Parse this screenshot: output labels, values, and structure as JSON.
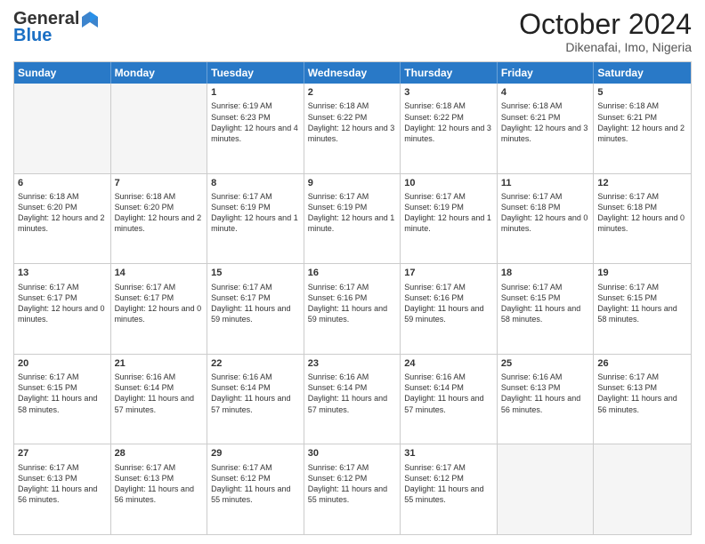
{
  "header": {
    "logo_general": "General",
    "logo_blue": "Blue",
    "month_title": "October 2024",
    "location": "Dikenafai, Imo, Nigeria"
  },
  "days_of_week": [
    "Sunday",
    "Monday",
    "Tuesday",
    "Wednesday",
    "Thursday",
    "Friday",
    "Saturday"
  ],
  "weeks": [
    [
      {
        "day": "",
        "empty": true
      },
      {
        "day": "",
        "empty": true
      },
      {
        "day": "1",
        "sunrise": "6:19 AM",
        "sunset": "6:23 PM",
        "daylight": "12 hours and 4 minutes."
      },
      {
        "day": "2",
        "sunrise": "6:18 AM",
        "sunset": "6:22 PM",
        "daylight": "12 hours and 3 minutes."
      },
      {
        "day": "3",
        "sunrise": "6:18 AM",
        "sunset": "6:22 PM",
        "daylight": "12 hours and 3 minutes."
      },
      {
        "day": "4",
        "sunrise": "6:18 AM",
        "sunset": "6:21 PM",
        "daylight": "12 hours and 3 minutes."
      },
      {
        "day": "5",
        "sunrise": "6:18 AM",
        "sunset": "6:21 PM",
        "daylight": "12 hours and 2 minutes."
      }
    ],
    [
      {
        "day": "6",
        "sunrise": "6:18 AM",
        "sunset": "6:20 PM",
        "daylight": "12 hours and 2 minutes."
      },
      {
        "day": "7",
        "sunrise": "6:18 AM",
        "sunset": "6:20 PM",
        "daylight": "12 hours and 2 minutes."
      },
      {
        "day": "8",
        "sunrise": "6:17 AM",
        "sunset": "6:19 PM",
        "daylight": "12 hours and 1 minute."
      },
      {
        "day": "9",
        "sunrise": "6:17 AM",
        "sunset": "6:19 PM",
        "daylight": "12 hours and 1 minute."
      },
      {
        "day": "10",
        "sunrise": "6:17 AM",
        "sunset": "6:19 PM",
        "daylight": "12 hours and 1 minute."
      },
      {
        "day": "11",
        "sunrise": "6:17 AM",
        "sunset": "6:18 PM",
        "daylight": "12 hours and 0 minutes."
      },
      {
        "day": "12",
        "sunrise": "6:17 AM",
        "sunset": "6:18 PM",
        "daylight": "12 hours and 0 minutes."
      }
    ],
    [
      {
        "day": "13",
        "sunrise": "6:17 AM",
        "sunset": "6:17 PM",
        "daylight": "12 hours and 0 minutes."
      },
      {
        "day": "14",
        "sunrise": "6:17 AM",
        "sunset": "6:17 PM",
        "daylight": "12 hours and 0 minutes."
      },
      {
        "day": "15",
        "sunrise": "6:17 AM",
        "sunset": "6:17 PM",
        "daylight": "11 hours and 59 minutes."
      },
      {
        "day": "16",
        "sunrise": "6:17 AM",
        "sunset": "6:16 PM",
        "daylight": "11 hours and 59 minutes."
      },
      {
        "day": "17",
        "sunrise": "6:17 AM",
        "sunset": "6:16 PM",
        "daylight": "11 hours and 59 minutes."
      },
      {
        "day": "18",
        "sunrise": "6:17 AM",
        "sunset": "6:15 PM",
        "daylight": "11 hours and 58 minutes."
      },
      {
        "day": "19",
        "sunrise": "6:17 AM",
        "sunset": "6:15 PM",
        "daylight": "11 hours and 58 minutes."
      }
    ],
    [
      {
        "day": "20",
        "sunrise": "6:17 AM",
        "sunset": "6:15 PM",
        "daylight": "11 hours and 58 minutes."
      },
      {
        "day": "21",
        "sunrise": "6:16 AM",
        "sunset": "6:14 PM",
        "daylight": "11 hours and 57 minutes."
      },
      {
        "day": "22",
        "sunrise": "6:16 AM",
        "sunset": "6:14 PM",
        "daylight": "11 hours and 57 minutes."
      },
      {
        "day": "23",
        "sunrise": "6:16 AM",
        "sunset": "6:14 PM",
        "daylight": "11 hours and 57 minutes."
      },
      {
        "day": "24",
        "sunrise": "6:16 AM",
        "sunset": "6:14 PM",
        "daylight": "11 hours and 57 minutes."
      },
      {
        "day": "25",
        "sunrise": "6:16 AM",
        "sunset": "6:13 PM",
        "daylight": "11 hours and 56 minutes."
      },
      {
        "day": "26",
        "sunrise": "6:17 AM",
        "sunset": "6:13 PM",
        "daylight": "11 hours and 56 minutes."
      }
    ],
    [
      {
        "day": "27",
        "sunrise": "6:17 AM",
        "sunset": "6:13 PM",
        "daylight": "11 hours and 56 minutes."
      },
      {
        "day": "28",
        "sunrise": "6:17 AM",
        "sunset": "6:13 PM",
        "daylight": "11 hours and 56 minutes."
      },
      {
        "day": "29",
        "sunrise": "6:17 AM",
        "sunset": "6:12 PM",
        "daylight": "11 hours and 55 minutes."
      },
      {
        "day": "30",
        "sunrise": "6:17 AM",
        "sunset": "6:12 PM",
        "daylight": "11 hours and 55 minutes."
      },
      {
        "day": "31",
        "sunrise": "6:17 AM",
        "sunset": "6:12 PM",
        "daylight": "11 hours and 55 minutes."
      },
      {
        "day": "",
        "empty": true
      },
      {
        "day": "",
        "empty": true
      }
    ]
  ]
}
